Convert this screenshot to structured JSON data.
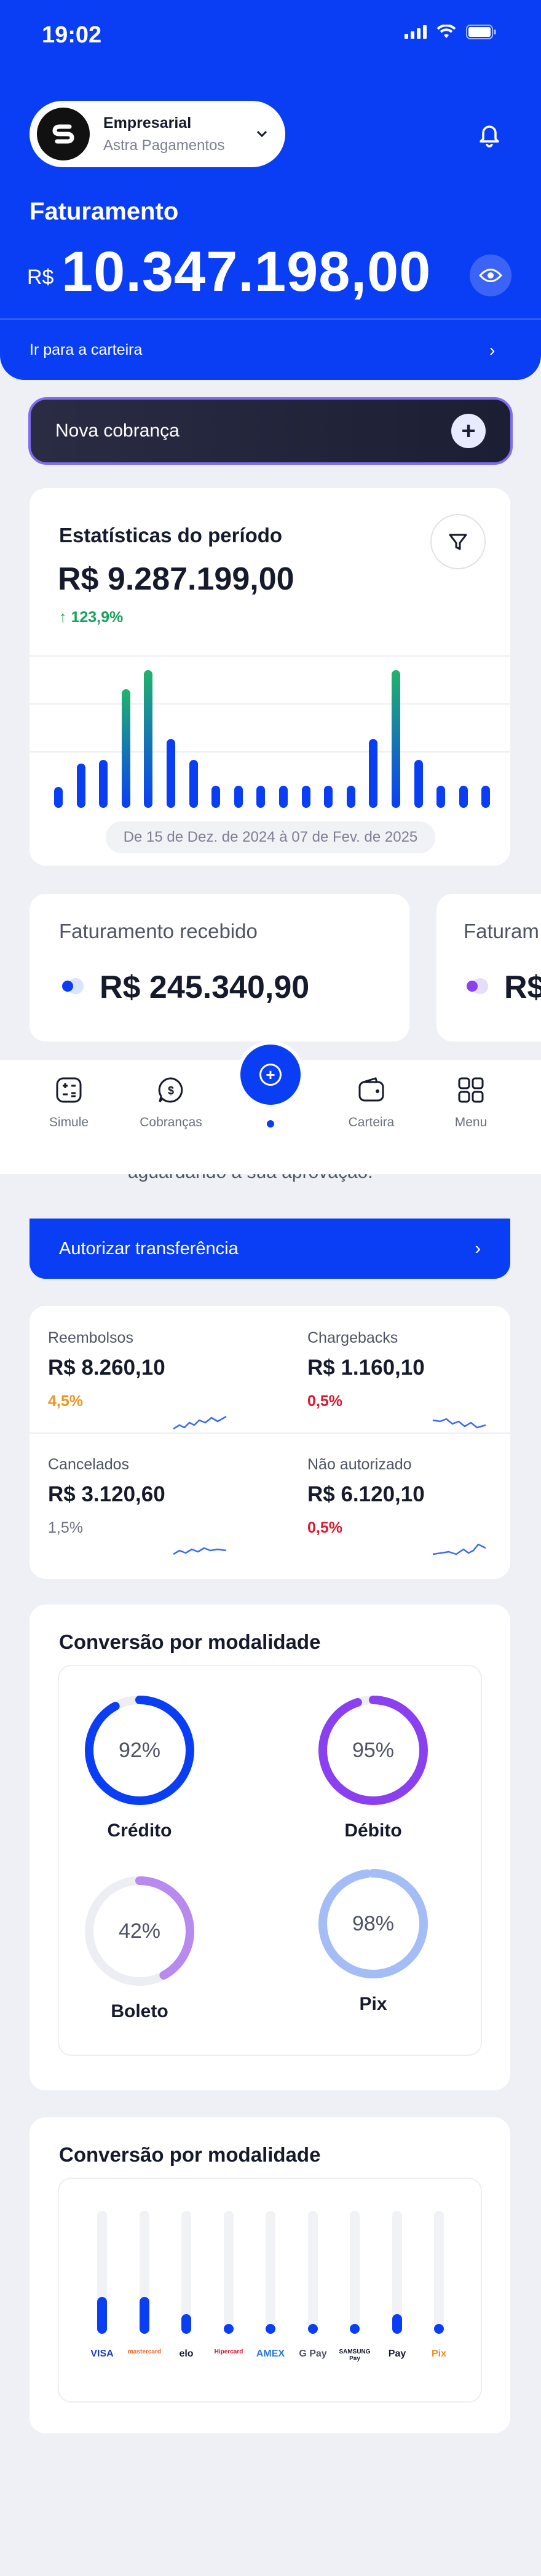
{
  "status_bar": {
    "time": "19:02"
  },
  "account": {
    "name": "Empresarial",
    "company": "Astra Pagamentos"
  },
  "billing": {
    "label": "Faturamento",
    "currency": "R$",
    "value": "10.347.198,00",
    "wallet_link": "Ir para a carteira"
  },
  "new_charge": {
    "label": "Nova cobrança"
  },
  "stats": {
    "title": "Estatísticas do período",
    "value": "R$ 9.287.199,00",
    "growth": "↑ 123,9%",
    "date_range": "De 15 de Dez. de 2024 à 07 de Fev. de 2025",
    "bars": [
      0.15,
      0.32,
      0.35,
      0.86,
      1.0,
      0.5,
      0.35,
      0.16,
      0.16,
      0.16,
      0.16,
      0.16,
      0.16,
      0.16,
      0.5,
      1.0,
      0.35,
      0.16,
      0.16,
      0.16
    ]
  },
  "received": [
    {
      "title": "Faturamento recebido",
      "value": "R$ 245.340,90"
    },
    {
      "title": "Faturam",
      "value": "R$"
    }
  ],
  "nav": {
    "simule": "Simule",
    "cobrancas": "Cobranças",
    "carteira": "Carteira",
    "menu": "Menu"
  },
  "authorization": {
    "message": "aguardando a sua aprovação.",
    "button": "Autorizar transferência"
  },
  "metrics": [
    {
      "label": "Reembolsos",
      "value": "R$ 8.260,10",
      "pct": "4,5%",
      "pct_color": "#f0961f"
    },
    {
      "label": "Chargebacks",
      "value": "R$ 1.160,10",
      "pct": "0,5%",
      "pct_color": "#e0182f"
    },
    {
      "label": "Cancelados",
      "value": "R$ 3.120,60",
      "pct": "1,5%",
      "pct_color": "#6b7080"
    },
    {
      "label": "Não autorizado",
      "value": "R$ 6.120,10",
      "pct": "0,5%",
      "pct_color": "#e0182f"
    }
  ],
  "conversion": {
    "title": "Conversão por modalidade",
    "items": [
      {
        "label": "Crédito",
        "pct": "92%",
        "value": 0.92,
        "color": "#0a3ef5"
      },
      {
        "label": "Débito",
        "pct": "95%",
        "value": 0.95,
        "color": "#8a3ff0"
      },
      {
        "label": "Boleto",
        "pct": "42%",
        "value": 0.42,
        "color": "#b88af0"
      },
      {
        "label": "Pix",
        "pct": "98%",
        "value": 0.98,
        "color": "#a5bdf7"
      }
    ]
  },
  "conversion_brands": {
    "title": "Conversão por modalidade",
    "items": [
      {
        "brand": "VISA",
        "value": 0.3,
        "color": "#1a3fbf"
      },
      {
        "brand": "mastercard",
        "value": 0.3,
        "color": "#eb5a1e"
      },
      {
        "brand": "elo",
        "value": 0.16,
        "color": "#151a2c"
      },
      {
        "brand": "Hipercard",
        "value": 0.08,
        "color": "#c8102e"
      },
      {
        "brand": "AMEX",
        "value": 0.06,
        "color": "#2a78d6"
      },
      {
        "brand": "G Pay",
        "value": 0.08,
        "color": "#4e5366"
      },
      {
        "brand": "SAMSUNG Pay",
        "value": 0.08,
        "color": "#151a2c"
      },
      {
        "brand": "Pay",
        "value": 0.16,
        "color": "#151a2c"
      },
      {
        "brand": "Pix",
        "value": 0.08,
        "color": "#f08a1e"
      }
    ]
  }
}
